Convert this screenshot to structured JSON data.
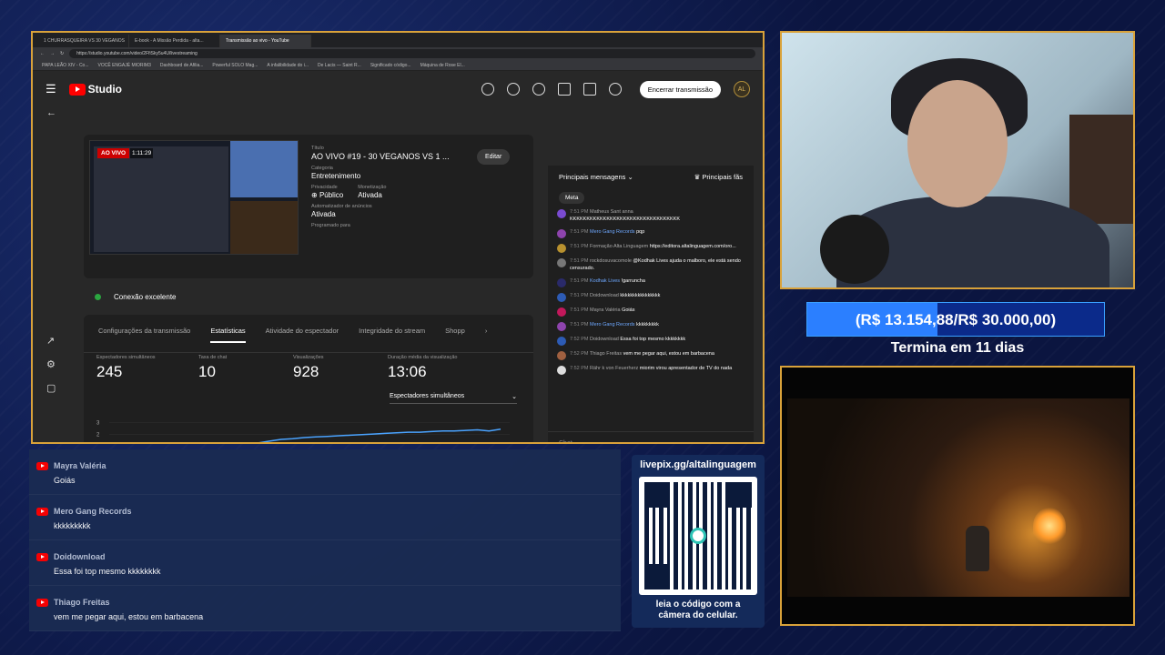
{
  "browser": {
    "tabs": [
      "1 CHURRASQUEIRA VS 30 VEGANOS",
      "E-book - A Missão Perdida - alta...",
      "Transmissão ao vivo - YouTube"
    ],
    "url": "https://studio.youtube.com/video/2FfiSky5u4U/livestreaming",
    "bookmarks": [
      "PAPA LEÃO XIV - Co...",
      "VOCÊ ENGAJÉ MIORIM3",
      "Dashboard de Afilia...",
      "Powerful SOLO Mag...",
      "A infalibilidade do i...",
      "De Lacis — Saint R...",
      "Significado código...",
      "Máquina de Rose El..."
    ]
  },
  "studio": {
    "logo": "Studio",
    "end_button": "Encerrar transmissão",
    "avatar": "AL",
    "live_badge": "AO VIVO",
    "live_time": "1:11:29",
    "title_label": "Título",
    "title": "AO VIVO #19 - 30 VEGANOS VS 1 ...",
    "edit": "Editar",
    "category_label": "Categoria",
    "category": "Entretenimento",
    "privacy_label": "Privacidade",
    "privacy": "Público",
    "monetization_label": "Monetização",
    "monetization": "Ativada",
    "automod_label": "Automatizador de anúncios",
    "automod": "Ativada",
    "scheduled_label": "Programado para",
    "connection": "Conexão excelente",
    "tabs": [
      "Configurações da transmissão",
      "Estatísticas",
      "Atividade do espectador",
      "Integridade do stream",
      "Shopp"
    ],
    "kpis": [
      {
        "label": "Espectadores simultâneos",
        "value": "245"
      },
      {
        "label": "Taxa de chat",
        "value": "10"
      },
      {
        "label": "Visualizações",
        "value": "928"
      },
      {
        "label": "Duração média da visualização",
        "value": "13:06"
      }
    ],
    "metric_select": "Espectadores simultâneos",
    "chart_ticks": [
      "3",
      "2",
      "1"
    ]
  },
  "chart_data": {
    "type": "line",
    "title": "",
    "xlabel": "",
    "ylabel": "",
    "ylim": [
      0,
      3.5
    ],
    "ticks": [
      "3",
      "2",
      "1"
    ],
    "values": [
      0.4,
      0.5,
      0.7,
      0.9,
      1.1,
      1.3,
      1.45,
      1.6,
      1.65,
      1.75,
      1.8,
      1.85,
      1.9,
      1.95,
      2.0,
      2.05,
      2.1,
      2.15,
      2.2,
      2.2,
      2.25,
      2.3,
      2.3,
      2.35,
      2.4,
      2.3,
      2.45
    ]
  },
  "chat": {
    "header": "Principais mensagens",
    "fans": "Principais fãs",
    "chip": "Meta",
    "input_placeholder": "Chat...",
    "messages": [
      {
        "time": "7:51 PM",
        "name": "Matheus Sant anna",
        "text": "KKKKKKKKKKKKKKKKKKKKKKKKKKKKKKKKK",
        "color": "#7a4bd1",
        "mod": false
      },
      {
        "time": "7:51 PM",
        "name": "Mero Gang Records",
        "text": "pqp",
        "color": "#8e44ad",
        "mod": true
      },
      {
        "time": "7:51 PM",
        "name": "Formação Alta Linguagem",
        "text": "https://editora.altalinguagem.com/oro...",
        "color": "#b8912f",
        "mod": false
      },
      {
        "time": "7:51 PM",
        "name": "rockdosuvacomole",
        "text": "@Kodhak Lives ajuda o malboro, ele está sendo censurado.",
        "color": "#777",
        "mod": false
      },
      {
        "time": "7:51 PM",
        "name": "Kodhak Lives",
        "text": "!garruncha",
        "color": "#2a2a6a",
        "mod": true
      },
      {
        "time": "7:51 PM",
        "name": "Doidownload",
        "text": "kkkkkkkkkkkkkkkk",
        "color": "#2d5bb5",
        "mod": false
      },
      {
        "time": "7:51 PM",
        "name": "Mayra Valéria",
        "text": "Goiás",
        "color": "#c2185b",
        "mod": false
      },
      {
        "time": "7:51 PM",
        "name": "Mero Gang Records",
        "text": "kkkkkkkkk",
        "color": "#8e44ad",
        "mod": true
      },
      {
        "time": "7:52 PM",
        "name": "Doidownload",
        "text": "Essa foi top mesmo kkkkkkkk",
        "color": "#2d5bb5",
        "mod": false
      },
      {
        "time": "7:52 PM",
        "name": "Thiago Freitas",
        "text": "vem me pegar aqui, estou em barbacena",
        "color": "#a06040",
        "mod": false
      },
      {
        "time": "7:52 PM",
        "name": "Rähr k von Feuerherz",
        "text": "miorim virou apresentador de TV do nada",
        "color": "#ddd",
        "mod": false
      }
    ]
  },
  "goal": {
    "text": "(R$ 13.154,88/R$ 30.000,00)",
    "progress": 0.438,
    "ends": "Termina em 11 dias"
  },
  "feed": [
    {
      "name": "Mayra Valéria",
      "msg": "Goiás"
    },
    {
      "name": "Mero Gang Records",
      "msg": "kkkkkkkkk"
    },
    {
      "name": "Doidownload",
      "msg": "Essa foi top mesmo kkkkkkkk"
    },
    {
      "name": "Thiago Freitas",
      "msg": "vem me pegar aqui, estou em barbacena"
    }
  ],
  "qr": {
    "header": "livepix.gg/altalinguagem",
    "footer1": "leia o código com a",
    "footer2": "câmera do celular."
  },
  "colors": {
    "frame": "#d9a23a",
    "accent": "#2b7fff",
    "live": "#cc0000"
  }
}
